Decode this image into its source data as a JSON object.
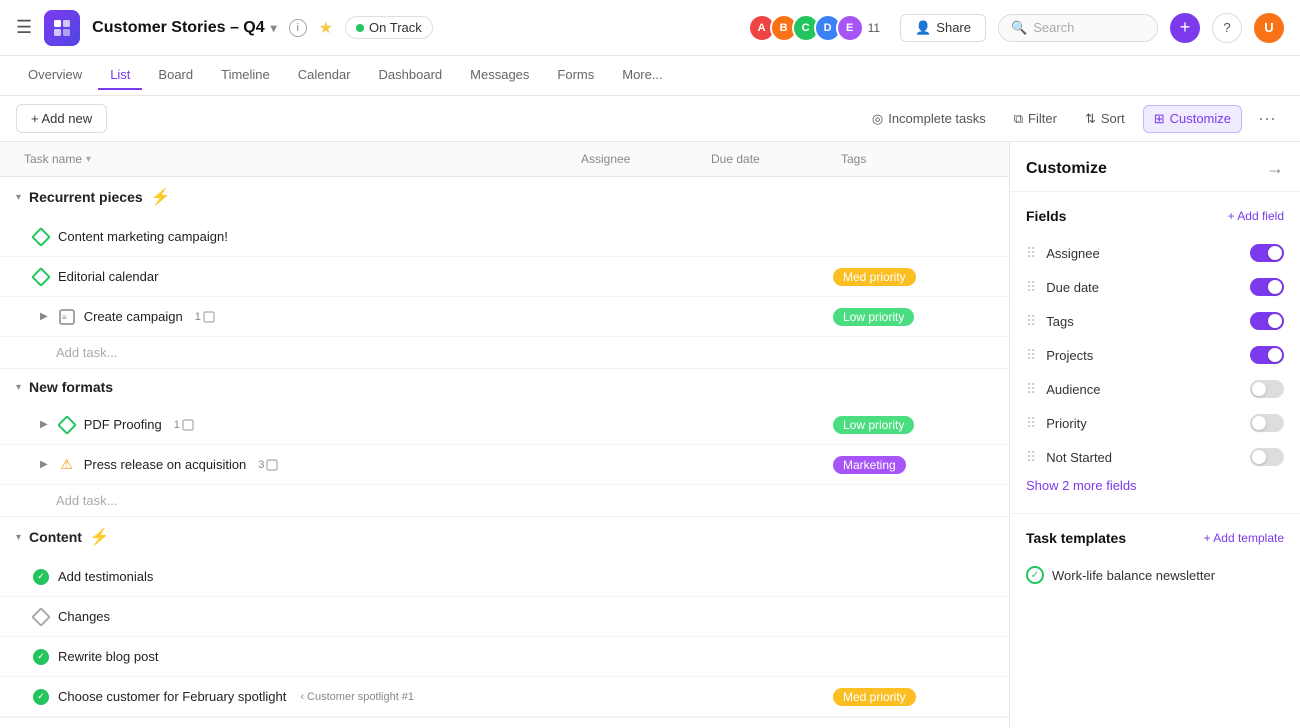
{
  "header": {
    "project_title": "Customer Stories – Q4",
    "status": "On Track",
    "avatar_count": "11",
    "share_label": "Share",
    "search_placeholder": "Search",
    "help_label": "?",
    "user_initials": "U"
  },
  "nav": {
    "tabs": [
      {
        "id": "overview",
        "label": "Overview",
        "active": false
      },
      {
        "id": "list",
        "label": "List",
        "active": true
      },
      {
        "id": "board",
        "label": "Board",
        "active": false
      },
      {
        "id": "timeline",
        "label": "Timeline",
        "active": false
      },
      {
        "id": "calendar",
        "label": "Calendar",
        "active": false
      },
      {
        "id": "dashboard",
        "label": "Dashboard",
        "active": false
      },
      {
        "id": "messages",
        "label": "Messages",
        "active": false
      },
      {
        "id": "forms",
        "label": "Forms",
        "active": false
      },
      {
        "id": "more",
        "label": "More...",
        "active": false
      }
    ]
  },
  "toolbar": {
    "add_new_label": "+ Add new",
    "incomplete_tasks_label": "Incomplete tasks",
    "filter_label": "Filter",
    "sort_label": "Sort",
    "customize_label": "Customize"
  },
  "columns": {
    "task_name": "Task name",
    "assignee": "Assignee",
    "due_date": "Due date",
    "tags": "Tags"
  },
  "sections": [
    {
      "id": "recurrent",
      "title": "Recurrent pieces",
      "emoji": "⚡",
      "tasks": [
        {
          "name": "Content marketing campaign!",
          "assignee": "",
          "due_date": "",
          "tag": null,
          "icon": "diamond",
          "indent": 0,
          "expand": false
        },
        {
          "name": "Editorial calendar",
          "assignee": "",
          "due_date": "",
          "tag": "Med priority",
          "tag_type": "med",
          "icon": "diamond",
          "indent": 0,
          "expand": false
        },
        {
          "name": "Create campaign",
          "assignee": "",
          "due_date": "",
          "tag": "Low priority",
          "tag_type": "low",
          "icon": "task",
          "indent": 1,
          "expand": true,
          "subtask_count": "1"
        },
        {
          "name": "Add task...",
          "assignee": "",
          "due_date": "",
          "tag": null,
          "icon": null,
          "indent": 0,
          "expand": false,
          "is_add": true
        }
      ]
    },
    {
      "id": "newformats",
      "title": "New formats",
      "emoji": null,
      "tasks": [
        {
          "name": "PDF Proofing",
          "assignee": "",
          "due_date": "",
          "tag": "Low priority",
          "tag_type": "low",
          "icon": "diamond",
          "indent": 1,
          "expand": true,
          "subtask_count": "1"
        },
        {
          "name": "Press release on acquisition",
          "assignee": "",
          "due_date": "",
          "tag": "Marketing",
          "tag_type": "marketing",
          "icon": "warning",
          "indent": 1,
          "expand": true,
          "subtask_count": "3"
        },
        {
          "name": "Add task...",
          "assignee": "",
          "due_date": "",
          "tag": null,
          "icon": null,
          "indent": 0,
          "expand": false,
          "is_add": true
        }
      ]
    },
    {
      "id": "content",
      "title": "Content",
      "emoji": "⚡",
      "tasks": [
        {
          "name": "Add testimonials",
          "assignee": "",
          "due_date": "",
          "tag": null,
          "icon": "circle-check",
          "indent": 0,
          "expand": false
        },
        {
          "name": "Changes",
          "assignee": "",
          "due_date": "",
          "tag": null,
          "icon": "diamond-outline",
          "indent": 0,
          "expand": false
        },
        {
          "name": "Rewrite blog post",
          "assignee": "",
          "due_date": "",
          "tag": null,
          "icon": "circle-check",
          "indent": 0,
          "expand": false
        },
        {
          "name": "Choose customer for February spotlight",
          "assignee": "",
          "due_date": "",
          "tag": "Med priority",
          "tag_type": "med",
          "icon": "circle-check",
          "indent": 0,
          "expand": false,
          "breadcrumb": "Customer spotlight #1"
        }
      ]
    }
  ],
  "customize_panel": {
    "title": "Customize",
    "fields_title": "Fields",
    "add_field_label": "+ Add field",
    "fields": [
      {
        "label": "Assignee",
        "on": true
      },
      {
        "label": "Due date",
        "on": true
      },
      {
        "label": "Tags",
        "on": true
      },
      {
        "label": "Projects",
        "on": true
      },
      {
        "label": "Audience",
        "on": false
      },
      {
        "label": "Priority",
        "on": false
      },
      {
        "label": "Not Started",
        "on": false
      }
    ],
    "show_more_label": "Show 2 more fields",
    "task_templates_title": "Task templates",
    "add_template_label": "+ Add template",
    "templates": [
      {
        "label": "Work-life balance newsletter"
      }
    ]
  }
}
